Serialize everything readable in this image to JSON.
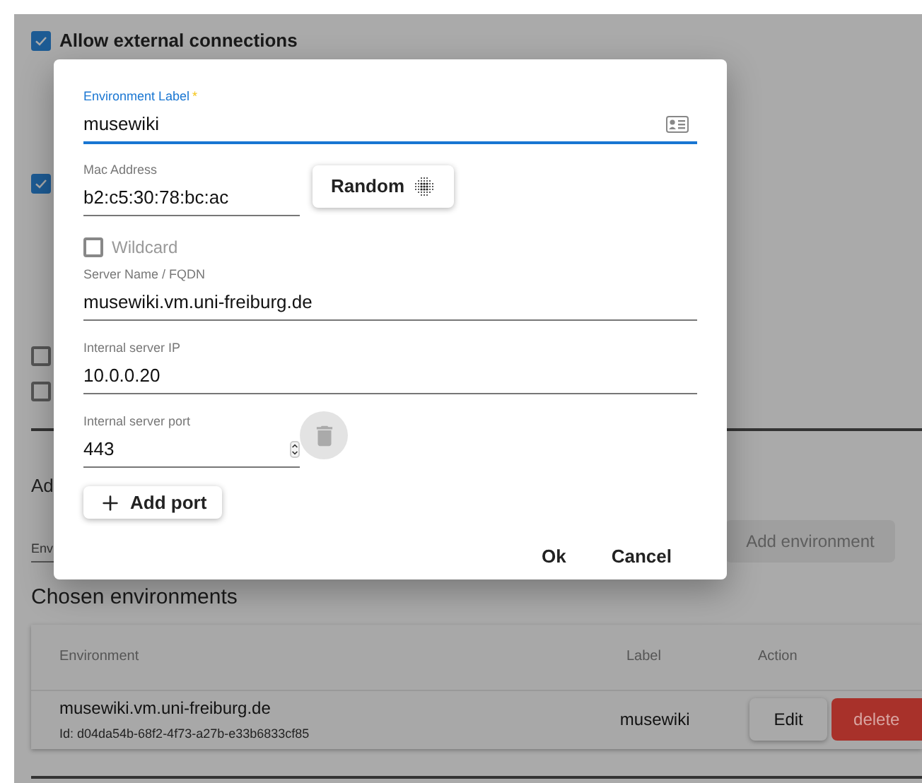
{
  "background": {
    "checkboxes": [
      {
        "label": "Allow external connections",
        "checked": true
      },
      {
        "checked": true
      },
      {
        "checked": false
      },
      {
        "checked": false
      }
    ],
    "section_heading": "Ad",
    "environment_field": {
      "placeholder": "Env"
    },
    "add_environment_button": {
      "label": "Add environment",
      "disabled": true
    },
    "chosen_heading": "Chosen environments",
    "table": {
      "columns": [
        "Environment",
        "Label",
        "Action"
      ],
      "rows": [
        {
          "environment": "musewiki.vm.uni-freiburg.de",
          "id": "Id: d04da54b-68f2-4f73-a27b-e33b6833cf85",
          "label": "musewiki",
          "edit": "Edit",
          "delete": "delete"
        }
      ]
    }
  },
  "dialog": {
    "fields": [
      {
        "kind": "label",
        "label": "Environment Label",
        "required_mark": "*",
        "value": "musewiki",
        "focused": true
      },
      {
        "kind": "mac",
        "label": "Mac Address",
        "value": "b2:c5:30:78:bc:ac",
        "button": "Random",
        "focused": false
      },
      {
        "kind": "checkbox",
        "label": "Wildcard",
        "checked": false
      },
      {
        "kind": "text",
        "label": "Server Name / FQDN",
        "value": "musewiki.vm.uni-freiburg.de",
        "focused": false
      },
      {
        "kind": "text",
        "label": "Internal server IP",
        "value": "10.0.0.20",
        "focused": false
      },
      {
        "kind": "port",
        "label": "Internal server port",
        "value": "443",
        "focused": false
      }
    ],
    "add_port_button": "Add port",
    "actions": [
      "Ok",
      "Cancel"
    ]
  }
}
